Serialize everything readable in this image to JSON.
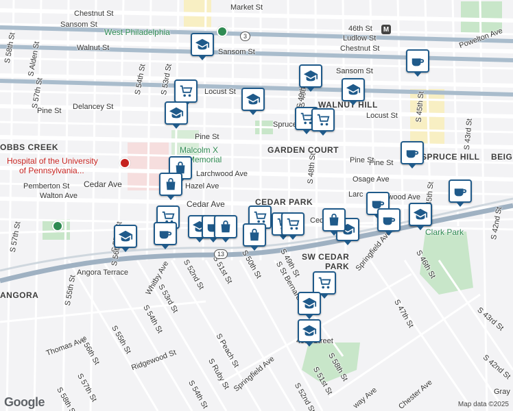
{
  "streets": [
    {
      "text": "Market St"
    },
    {
      "text": "Chestnut St"
    },
    {
      "text": "Sansom St"
    },
    {
      "text": "Sansom St"
    },
    {
      "text": "Walnut St"
    },
    {
      "text": "Ludlow St"
    },
    {
      "text": "Chestnut St"
    },
    {
      "text": "Sansom St"
    },
    {
      "text": "Locust St"
    },
    {
      "text": "Locust St"
    },
    {
      "text": "Delancey St"
    },
    {
      "text": "Pine St"
    },
    {
      "text": "Pine St"
    },
    {
      "text": "Spruce St"
    },
    {
      "text": "Larchwood Ave"
    },
    {
      "text": "Hazel Ave"
    },
    {
      "text": "Cedar Ave"
    },
    {
      "text": "Cedar Ave"
    },
    {
      "text": "Pemberton St"
    },
    {
      "text": "Walton Ave"
    },
    {
      "text": "Osage Ave"
    },
    {
      "text": "Pine St"
    },
    {
      "text": "Angora Terrace"
    },
    {
      "text": "Whitby Ave"
    },
    {
      "text": "S 52nd St"
    },
    {
      "text": "S 51st St"
    },
    {
      "text": "S 50th St"
    },
    {
      "text": "S 49th St"
    },
    {
      "text": "S 48th St"
    },
    {
      "text": "S 49th St"
    },
    {
      "text": "S 53rd St"
    },
    {
      "text": "S 54th St"
    },
    {
      "text": "S 55th St"
    },
    {
      "text": "S 56th St"
    },
    {
      "text": "S 57th St"
    },
    {
      "text": "S 58th St"
    },
    {
      "text": "Thomas Ave"
    },
    {
      "text": "Ridgewood St"
    },
    {
      "text": "S Peach St"
    },
    {
      "text": "S Ruby St"
    },
    {
      "text": "Springfield Ave"
    },
    {
      "text": "S 51st St"
    },
    {
      "text": "S 52nd St"
    },
    {
      "text": "Springfield Ave"
    },
    {
      "text": "S 47th St"
    },
    {
      "text": "S 46th St"
    },
    {
      "text": "S 45th St"
    },
    {
      "text": "S 43rd St"
    },
    {
      "text": "S 42nd St"
    },
    {
      "text": "S 43rd St"
    },
    {
      "text": "Powelton Ave"
    },
    {
      "text": "46th St"
    },
    {
      "text": "S 58th St"
    },
    {
      "text": "S Alden St"
    },
    {
      "text": "S 57th St"
    },
    {
      "text": "S 55th St"
    },
    {
      "text": "S 54th St"
    },
    {
      "text": "S 53rd St"
    },
    {
      "text": "S 49th St"
    },
    {
      "text": "Sansom St"
    },
    {
      "text": "Larchwood Ave"
    },
    {
      "text": "49th Street"
    },
    {
      "text": "S 45th St"
    },
    {
      "text": "S 54th St"
    },
    {
      "text": "S 55th St"
    },
    {
      "text": "S 56th St"
    },
    {
      "text": "S 57th St"
    },
    {
      "text": "S 58th St"
    },
    {
      "text": "S St Bernard St"
    },
    {
      "text": "Gray"
    },
    {
      "text": "way Ave"
    },
    {
      "text": "Chester Ave"
    },
    {
      "text": "S 42nd St"
    },
    {
      "text": "Pine St"
    },
    {
      "text": "Ced"
    },
    {
      "text": "Larc"
    }
  ],
  "areas": [
    {
      "text": "GARDEN COURT"
    },
    {
      "text": "CEDAR PARK"
    },
    {
      "text": "SW CEDAR"
    },
    {
      "text": "PARK"
    },
    {
      "text": "WALNUT HILL"
    },
    {
      "text": "SPRUCE HILL"
    },
    {
      "text": "OBBS CREEK"
    },
    {
      "text": "ANGORA"
    },
    {
      "text": "BEIG"
    }
  ],
  "green_labels": [
    {
      "text": "West Philadelphia"
    },
    {
      "text": "Malcolm X"
    },
    {
      "text": "Memorial"
    },
    {
      "text": "Clark Park"
    }
  ],
  "red_labels": [
    {
      "text": "Hospital of the University"
    },
    {
      "text": "of Pennsylvania..."
    }
  ],
  "metro_labels": [
    "M"
  ],
  "route_shields": [
    "3",
    "13"
  ],
  "markers": [
    {
      "type": "school-icon"
    },
    {
      "type": "cart-icon"
    },
    {
      "type": "school-icon"
    },
    {
      "type": "school-icon"
    },
    {
      "type": "school-icon"
    },
    {
      "type": "school-icon"
    },
    {
      "type": "cart-icon"
    },
    {
      "type": "cart-icon"
    },
    {
      "type": "coffee-icon"
    },
    {
      "type": "coffee-icon"
    },
    {
      "type": "coffee-icon"
    },
    {
      "type": "bag-icon"
    },
    {
      "type": "bag-icon"
    },
    {
      "type": "cart-icon"
    },
    {
      "type": "school-icon"
    },
    {
      "type": "coffee-icon"
    },
    {
      "type": "school-icon"
    },
    {
      "type": "coffee-icon"
    },
    {
      "type": "cart-icon"
    },
    {
      "type": "bag-icon"
    },
    {
      "type": "bag-icon"
    },
    {
      "type": "cart-icon"
    },
    {
      "type": "cart-icon"
    },
    {
      "type": "school-icon"
    },
    {
      "type": "bag-icon"
    },
    {
      "type": "school-icon"
    },
    {
      "type": "coffee-icon"
    },
    {
      "type": "coffee-icon"
    },
    {
      "type": "school-icon"
    },
    {
      "type": "cart-icon"
    },
    {
      "type": "school-icon"
    },
    {
      "type": "school-icon"
    }
  ],
  "footer": {
    "google": "Google",
    "copyright": "Map data ©2025"
  },
  "colors": {
    "marker_border": "#1f5a8a",
    "park": "#c8e6c9",
    "hospital": "#f6dede",
    "road_major": "#ffffff",
    "road_highway": "#a9bccc"
  }
}
